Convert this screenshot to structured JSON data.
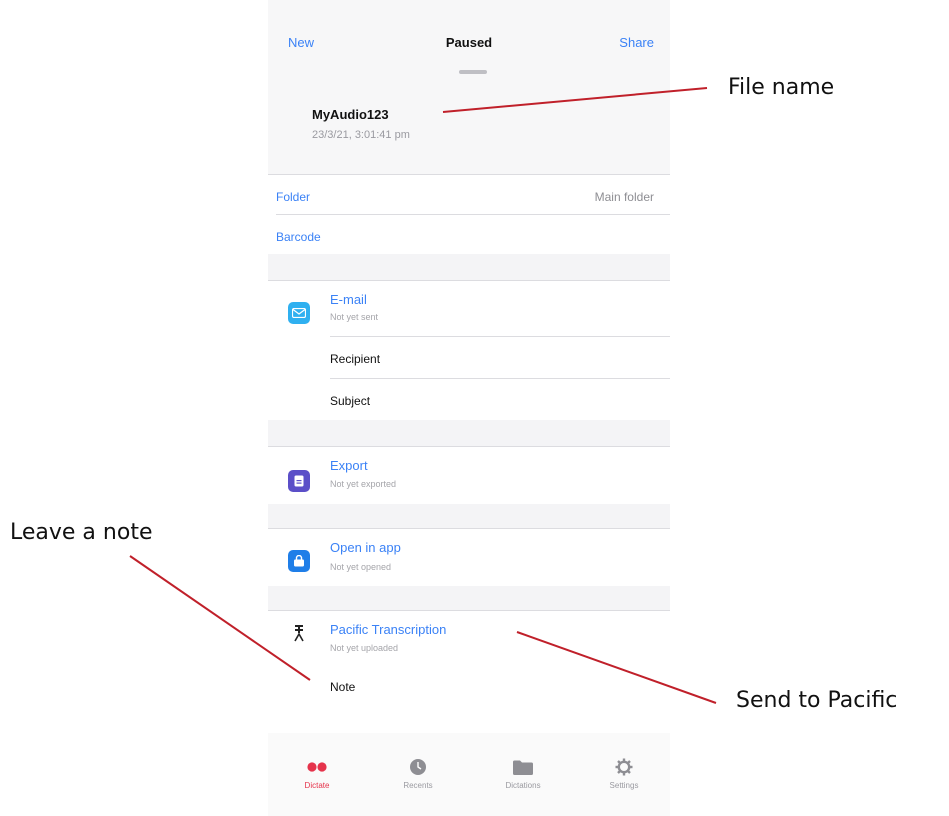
{
  "nav": {
    "new_label": "New",
    "title": "Paused",
    "share_label": "Share"
  },
  "file": {
    "name": "MyAudio123",
    "date": "23/3/21, 3:01:41 pm"
  },
  "rows": {
    "folder_label": "Folder",
    "folder_value": "Main folder",
    "barcode_label": "Barcode"
  },
  "email": {
    "title": "E-mail",
    "status": "Not yet sent",
    "recipient_label": "Recipient",
    "subject_label": "Subject"
  },
  "export": {
    "title": "Export",
    "status": "Not yet exported"
  },
  "open_in_app": {
    "title": "Open in app",
    "status": "Not yet opened"
  },
  "pacific": {
    "title": "Pacific Transcription",
    "status": "Not yet uploaded",
    "note_label": "Note"
  },
  "tabbar": {
    "items": [
      {
        "label": "Dictate",
        "icon": "record-icon",
        "active": true
      },
      {
        "label": "Recents",
        "icon": "clock-icon",
        "active": false
      },
      {
        "label": "Dictations",
        "icon": "folder-icon",
        "active": false
      },
      {
        "label": "Settings",
        "icon": "gear-icon",
        "active": false
      }
    ]
  },
  "annotations": {
    "file_name": "File name",
    "leave_note": "Leave a note",
    "send_pacific": "Send to Pacific"
  },
  "colors": {
    "accent": "#3b82f6",
    "active_tab": "#e5334b",
    "annotation_line": "#c0202a",
    "email_icon": "#2fb0f0",
    "export_icon": "#5b4fc8",
    "open_app_icon": "#1f7ee8"
  }
}
